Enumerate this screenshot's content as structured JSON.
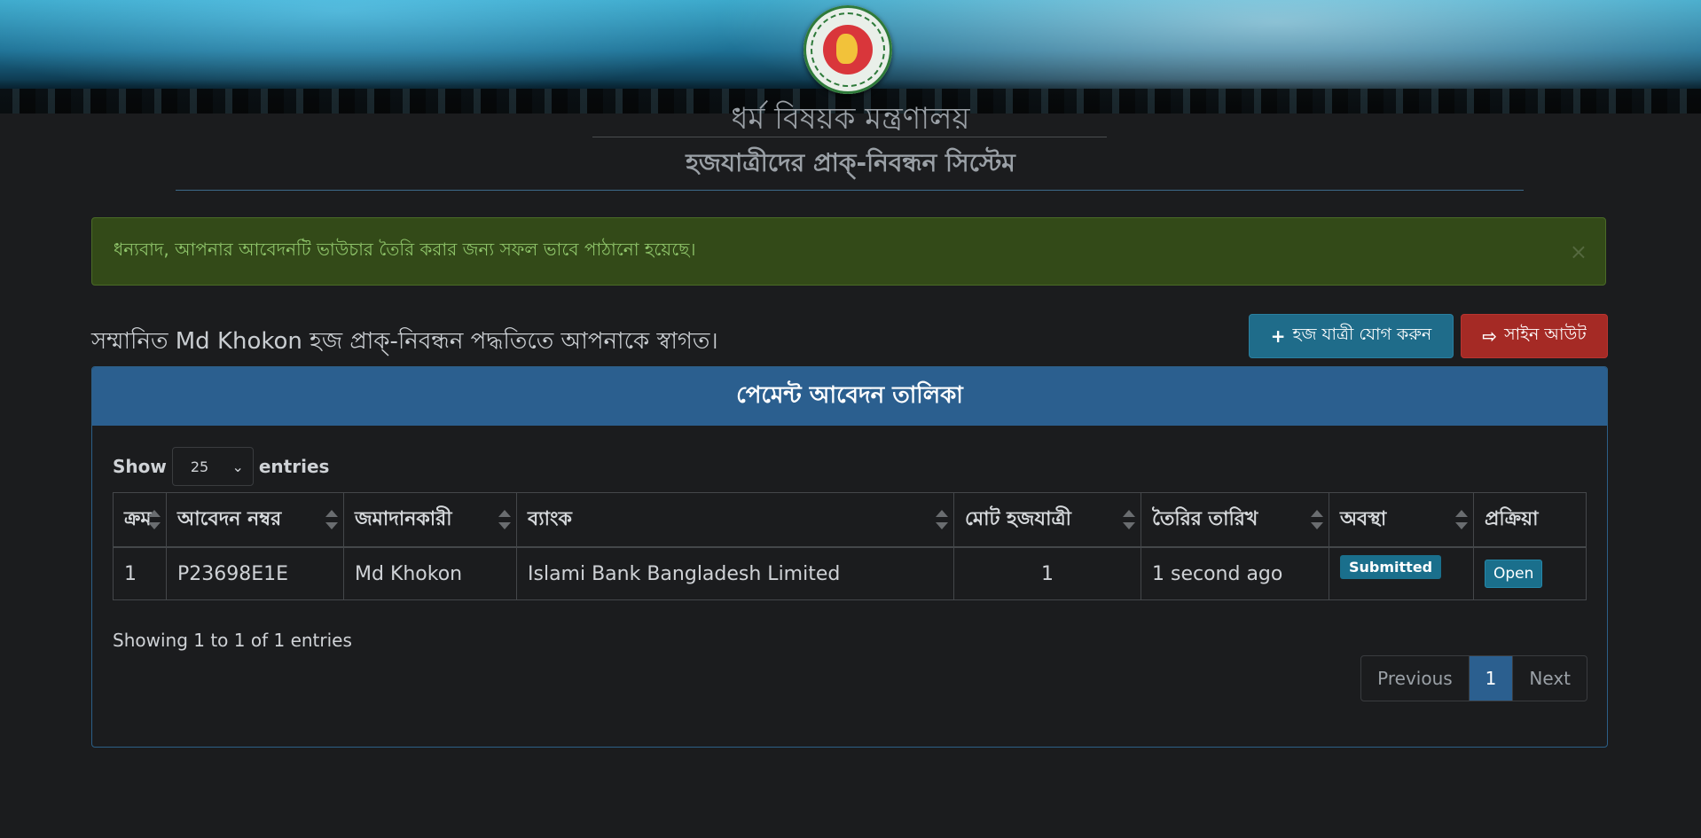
{
  "header": {
    "ministry": "ধর্ম বিষয়ক মন্ত্রণালয়",
    "system": "হজযাত্রীদের প্রাক্-নিবন্ধন সিস্টেম"
  },
  "alert": {
    "message": "ধন্যবাদ, আপনার আবেদনটি ভাউচার তৈরি করার জন্য সফল ভাবে পাঠানো হয়েছে।",
    "close": "×"
  },
  "welcome": "সম্মানিত Md Khokon হজ প্রাক্-নিবন্ধন পদ্ধতিতে আপনাকে স্বাগত।",
  "buttons": {
    "add_pilgrim": "হজ যাত্রী যোগ করুন",
    "add_icon": "+",
    "sign_out": "সাইন আউট",
    "sign_out_icon": "⇨"
  },
  "panel": {
    "title": "পেমেন্ট আবেদন তালিকা",
    "show_label": "Show",
    "entries_label": "entries",
    "page_length": "25",
    "columns": [
      "ক্রম",
      "আবেদন নম্বর",
      "জমাদানকারী",
      "ব্যাংক",
      "মোট হজযাত্রী",
      "তৈরির তারিখ",
      "অবস্থা",
      "প্রক্রিয়া"
    ],
    "rows": [
      {
        "serial": "1",
        "application_no": "P23698E1E",
        "depositor": "Md Khokon",
        "bank": "Islami Bank Bangladesh Limited",
        "total_pilgrims": "1",
        "created": "1 second ago",
        "status": "Submitted",
        "action": "Open"
      }
    ],
    "info": "Showing 1 to 1 of 1 entries",
    "pagination": {
      "previous": "Previous",
      "current": "1",
      "next": "Next"
    }
  },
  "colors": {
    "panel_header": "#2b5f8f",
    "alert_bg": "#334a18",
    "add_button": "#1f6c8a",
    "signout_button": "#a52a25",
    "badge": "#1a6f8c"
  }
}
